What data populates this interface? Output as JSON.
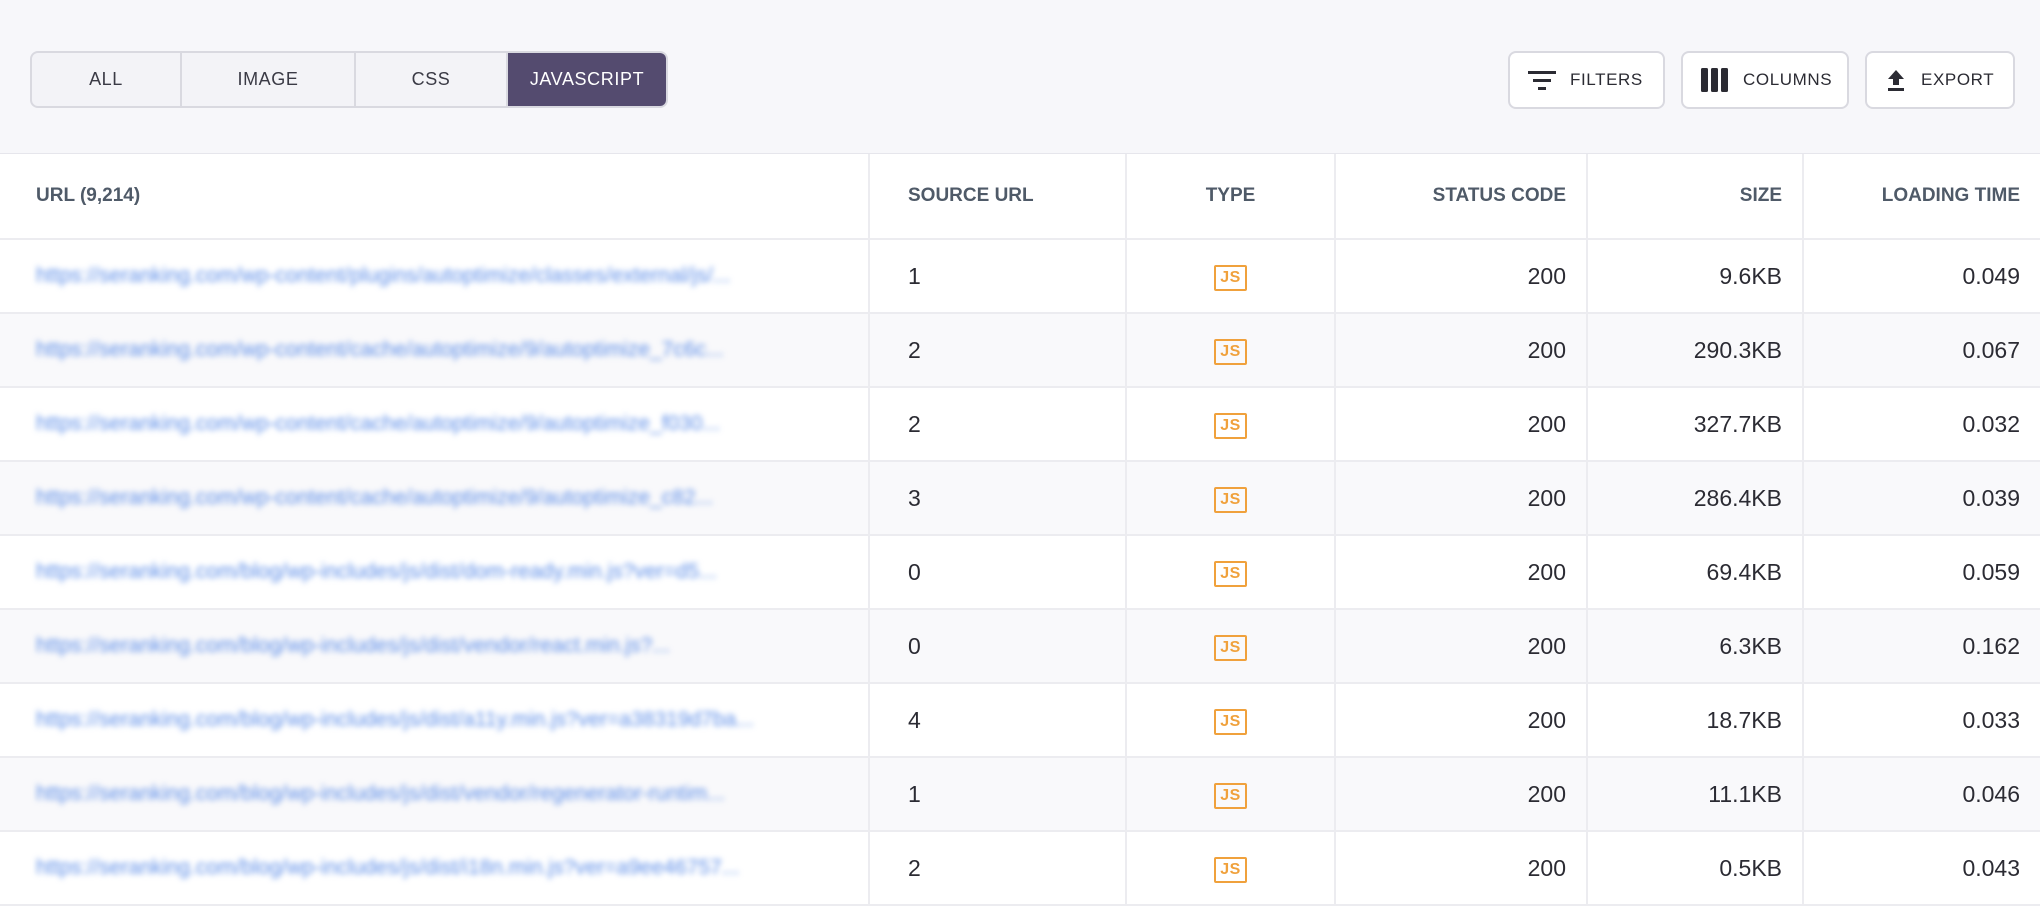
{
  "tabs": [
    {
      "label": "ALL",
      "active": false
    },
    {
      "label": "IMAGE",
      "active": false
    },
    {
      "label": "CSS",
      "active": false
    },
    {
      "label": "JAVASCRIPT",
      "active": true
    }
  ],
  "actions": {
    "filters": {
      "label": "FILTERS",
      "icon": "filter-icon"
    },
    "columns": {
      "label": "COLUMNS",
      "icon": "columns-icon"
    },
    "export": {
      "label": "EXPORT",
      "icon": "upload-icon"
    }
  },
  "colors": {
    "accent": "#544b6f",
    "link": "#5f8fe8",
    "badge": "#f0a13c"
  },
  "table": {
    "headers": {
      "url": "URL (9,214)",
      "source": "SOURCE URL",
      "type": "TYPE",
      "status": "STATUS CODE",
      "size": "SIZE",
      "time": "LOADING TIME"
    },
    "rows": [
      {
        "url": "https://seranking.com/wp-content/plugins/autoptimize/classes/external/js/...",
        "source": "1",
        "type": "JS",
        "status": "200",
        "size": "9.6KB",
        "time": "0.049"
      },
      {
        "url": "https://seranking.com/wp-content/cache/autoptimize/9/autoptimize_7c6c...",
        "source": "2",
        "type": "JS",
        "status": "200",
        "size": "290.3KB",
        "time": "0.067"
      },
      {
        "url": "https://seranking.com/wp-content/cache/autoptimize/9/autoptimize_f030...",
        "source": "2",
        "type": "JS",
        "status": "200",
        "size": "327.7KB",
        "time": "0.032"
      },
      {
        "url": "https://seranking.com/wp-content/cache/autoptimize/9/autoptimize_c82...",
        "source": "3",
        "type": "JS",
        "status": "200",
        "size": "286.4KB",
        "time": "0.039"
      },
      {
        "url": "https://seranking.com/blog/wp-includes/js/dist/dom-ready.min.js?ver=d5...",
        "source": "0",
        "type": "JS",
        "status": "200",
        "size": "69.4KB",
        "time": "0.059"
      },
      {
        "url": "https://seranking.com/blog/wp-includes/js/dist/vendor/react.min.js?...",
        "source": "0",
        "type": "JS",
        "status": "200",
        "size": "6.3KB",
        "time": "0.162"
      },
      {
        "url": "https://seranking.com/blog/wp-includes/js/dist/a11y.min.js?ver=a38319d7ba...",
        "source": "4",
        "type": "JS",
        "status": "200",
        "size": "18.7KB",
        "time": "0.033"
      },
      {
        "url": "https://seranking.com/blog/wp-includes/js/dist/vendor/regenerator-runtim...",
        "source": "1",
        "type": "JS",
        "status": "200",
        "size": "11.1KB",
        "time": "0.046"
      },
      {
        "url": "https://seranking.com/blog/wp-includes/js/dist/i18n.min.js?ver=a9ee46757...",
        "source": "2",
        "type": "JS",
        "status": "200",
        "size": "0.5KB",
        "time": "0.043"
      }
    ]
  }
}
